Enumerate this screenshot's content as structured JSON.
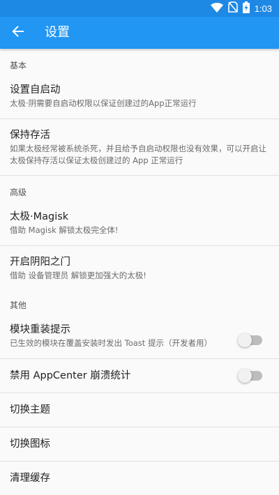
{
  "status_bar": {
    "time": "1:03",
    "icons": [
      "wifi-icon",
      "no-sim-icon",
      "battery-charging-icon"
    ]
  },
  "app_bar": {
    "back_icon": "arrow-back-icon",
    "title": "设置"
  },
  "colors": {
    "status_bar": "#1e88e5",
    "app_bar": "#2196f3",
    "background": "#fafafa"
  },
  "sections": {
    "basic": "基本",
    "advanced": "高级",
    "other": "其他"
  },
  "items": {
    "autostart": {
      "title": "设置自启动",
      "summary": "太极·阴需要自启动权限以保证创建过的App正常运行"
    },
    "keep_alive": {
      "title": "保持存活",
      "summary": "如果太极经常被系统杀死，并且给予自启动权限也没有效果，可以开启让太极保持存活以保证太极创建过的 App 正常运行"
    },
    "magisk": {
      "title": "太极·Magisk",
      "summary": "借助 Magisk 解锁太极完全体!"
    },
    "yinyang": {
      "title": "开启阴阳之门",
      "summary": "借助 设备管理员 解锁更加强大的太极!"
    },
    "reinstall_hint": {
      "title": "模块重装提示",
      "summary": "已生效的模块在覆盖安装时发出 Toast 提示（开发者用）",
      "enabled": false
    },
    "appcenter": {
      "title": "禁用 AppCenter 崩溃统计",
      "enabled": false
    },
    "switch_theme": {
      "title": "切换主题"
    },
    "switch_icon": {
      "title": "切换图标"
    },
    "clear_cache": {
      "title": "清理缓存"
    }
  }
}
